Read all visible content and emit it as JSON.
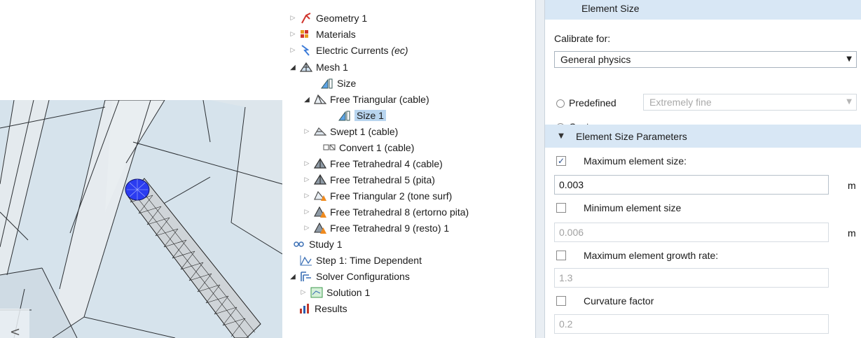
{
  "viewport": {
    "back_arrow": "<"
  },
  "tree": {
    "items": [
      {
        "label": "Geometry 1",
        "icon": "geometry-icon",
        "twisty": "closed"
      },
      {
        "label": "Materials",
        "icon": "materials-icon",
        "twisty": "closed"
      },
      {
        "label": "Electric Currents",
        "label_suffix": "(ec)",
        "icon": "electric-currents-icon",
        "twisty": "closed"
      },
      {
        "label": "Mesh 1",
        "icon": "mesh-icon",
        "twisty": "open"
      },
      {
        "label": "Size",
        "icon": "size-icon",
        "twisty": "none"
      },
      {
        "label": "Free Triangular  (cable)",
        "icon": "free-triangular-icon",
        "twisty": "open"
      },
      {
        "label": "Size 1",
        "icon": "size-icon",
        "twisty": "none",
        "selected": true
      },
      {
        "label": "Swept 1 (cable)",
        "icon": "swept-icon",
        "twisty": "closed"
      },
      {
        "label": "Convert 1 (cable)",
        "icon": "convert-icon",
        "twisty": "none"
      },
      {
        "label": "Free Tetrahedral 4 (cable)",
        "icon": "free-tetrahedral-icon",
        "twisty": "closed"
      },
      {
        "label": "Free Tetrahedral 5 (pita)",
        "icon": "free-tetrahedral-icon",
        "twisty": "closed"
      },
      {
        "label": "Free Triangular 2 (tone surf)",
        "icon": "free-triangular-warning-icon",
        "twisty": "closed"
      },
      {
        "label": "Free Tetrahedral 8 (ertorno pita)",
        "icon": "free-tetrahedral-warning-icon",
        "twisty": "closed"
      },
      {
        "label": "Free Tetrahedral 9 (resto) 1",
        "icon": "free-tetrahedral-warning-icon",
        "twisty": "closed"
      },
      {
        "label": "Study 1",
        "icon": "study-icon",
        "twisty": "none"
      },
      {
        "label": "Step 1: Time Dependent",
        "icon": "time-dependent-icon",
        "twisty": "none"
      },
      {
        "label": "Solver Configurations",
        "icon": "solver-configurations-icon",
        "twisty": "open"
      },
      {
        "label": "Solution 1",
        "icon": "solution-icon",
        "twisty": "closed"
      },
      {
        "label": "Results",
        "icon": "results-icon",
        "twisty": "none"
      }
    ]
  },
  "settings": {
    "element_size": {
      "header": "Element Size",
      "calibrate_label": "Calibrate for:",
      "calibrate_value": "General physics",
      "predefined_label": "Predefined",
      "predefined_value": "Extremely fine",
      "custom_label": "Custom",
      "selected_option": "custom"
    },
    "parameters": {
      "header": "Element Size Parameters",
      "max_size_label": "Maximum element size:",
      "max_size_value": "0.003",
      "max_size_checked": true,
      "min_size_label": "Minimum element size",
      "min_size_value": "0.006",
      "min_size_checked": false,
      "growth_rate_label": "Maximum element growth rate:",
      "growth_rate_value": "1.3",
      "growth_rate_checked": false,
      "curvature_label": "Curvature factor",
      "curvature_value": "0.2",
      "curvature_checked": false,
      "unit": "m"
    }
  },
  "colors": {
    "accent": "#3d6fb4",
    "selection": "#b8d5ef",
    "section_header": "#d8e7f5",
    "viewport_bg": "#d6e3ec",
    "mesh_highlight": "#2b3cf0"
  }
}
